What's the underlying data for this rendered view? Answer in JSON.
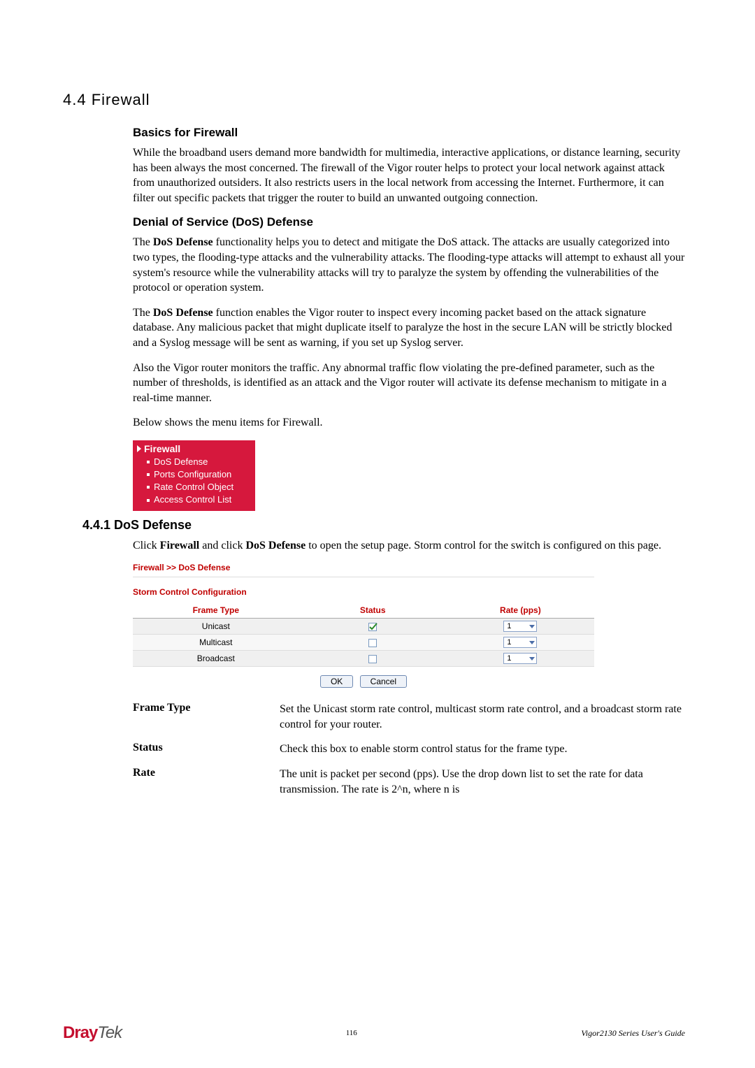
{
  "section": {
    "number": "4.4 Firewall",
    "basics_head": "Basics for Firewall",
    "basics_para": "While the broadband users demand more bandwidth for multimedia, interactive applications, or distance learning, security has been always the most concerned. The firewall of the Vigor router helps to protect your local network against attack from unauthorized outsiders. It also restricts users in the local network from accessing the Internet. Furthermore, it can filter out specific packets that trigger the router to build an unwanted outgoing connection.",
    "dos_head": "Denial of Service (DoS) Defense",
    "dos_p1_pre": "The ",
    "dos_p1_bold": "DoS Defense",
    "dos_p1_post": " functionality helps you to detect and mitigate the DoS attack. The attacks are usually categorized into two types, the flooding-type attacks and the vulnerability attacks. The flooding-type attacks will attempt to exhaust all your system's resource while the vulnerability attacks will try to paralyze the system by offending the vulnerabilities of the protocol or operation system.",
    "dos_p2_pre": "The ",
    "dos_p2_bold": "DoS Defense",
    "dos_p2_post": " function enables the Vigor router to inspect every incoming packet based on the attack signature database. Any malicious packet that might duplicate itself to paralyze the host in the secure LAN will be strictly blocked and a Syslog message will be sent as warning, if you set up Syslog server.",
    "dos_p3": "Also the Vigor router monitors the traffic. Any abnormal traffic flow violating the pre-defined parameter, such as the number of thresholds, is identified as an attack and the Vigor router will activate its defense mechanism to mitigate in a real-time manner.",
    "dos_p4": "Below shows the menu items for Firewall."
  },
  "menu": {
    "head": "Firewall",
    "items": [
      "DoS Defense",
      "Ports Configuration",
      "Rate Control Object",
      "Access Control List"
    ]
  },
  "subsection": {
    "head": "4.4.1 DoS Defense",
    "intro_pre": "Click ",
    "intro_b1": "Firewall",
    "intro_mid": " and click ",
    "intro_b2": "DoS Defense",
    "intro_post": " to open the setup page. Storm control for the switch is configured on this page."
  },
  "dosbox": {
    "crumb": "Firewall >> DoS Defense",
    "storm_title": "Storm Control Configuration",
    "headers": {
      "frame": "Frame Type",
      "status": "Status",
      "rate": "Rate (pps)"
    },
    "rows": [
      {
        "frame": "Unicast",
        "checked": true,
        "rate": "1"
      },
      {
        "frame": "Multicast",
        "checked": false,
        "rate": "1"
      },
      {
        "frame": "Broadcast",
        "checked": false,
        "rate": "1"
      }
    ],
    "ok": "OK",
    "cancel": "Cancel"
  },
  "params": {
    "items": [
      {
        "label": "Frame Type",
        "desc": "Set the Unicast storm rate control, multicast storm rate control, and a broadcast storm rate control for your router."
      },
      {
        "label": "Status",
        "desc": "Check this box to enable storm control status for the frame type."
      },
      {
        "label": "Rate",
        "desc": "The unit is packet per second (pps). Use the drop down list to set the rate for data transmission. The rate is 2^n, where n is"
      }
    ]
  },
  "footer": {
    "brand1": "Dray",
    "brand2": "Tek",
    "page": "116",
    "guide": "Vigor2130  Series  User's  Guide"
  }
}
